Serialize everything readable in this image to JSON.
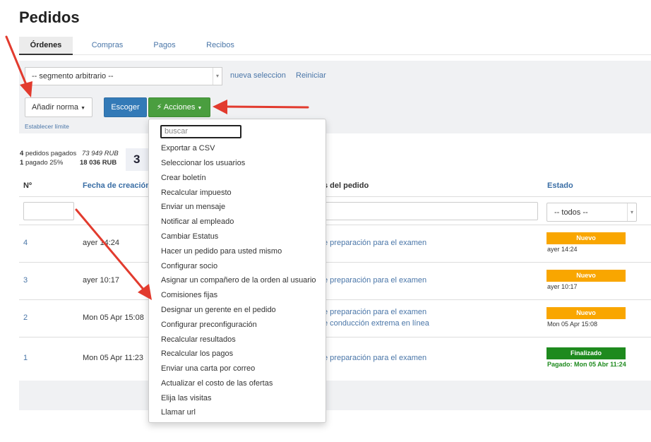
{
  "page": {
    "title": "Pedidos"
  },
  "tabs": [
    {
      "label": "Órdenes",
      "active": true
    },
    {
      "label": "Compras",
      "active": false
    },
    {
      "label": "Pagos",
      "active": false
    },
    {
      "label": "Recibos",
      "active": false
    }
  ],
  "filters": {
    "segment_value": "-- segmento arbitrario --",
    "new_selection": "nueva seleccion",
    "reset": "Reiniciar",
    "add_rule": "Añadir norma",
    "choose": "Escoger",
    "actions": "Acciones",
    "set_limit": "Establecer límite"
  },
  "stats": {
    "paid_count": "4",
    "paid_label": "pedidos pagados",
    "paid_amount": "73 949 RUB",
    "partial_count": "1",
    "partial_label": "pagado 25%",
    "partial_amount": "18 036 RUB",
    "box_value": "3"
  },
  "table": {
    "col_num": "Nº",
    "col_date": "Fecha de creación",
    "col_order": "s del pedido",
    "col_status": "Estado",
    "status_filter": "-- todos --",
    "rows": [
      {
        "id": "4",
        "date": "ayer 14:24",
        "line1": "e preparación para el examen",
        "line2": "",
        "badge": "Nuevo",
        "badge_date": "ayer 14:24"
      },
      {
        "id": "3",
        "date": "ayer 10:17",
        "line1": "e preparación para el examen",
        "line2": "",
        "badge": "Nuevo",
        "badge_date": "ayer 10:17"
      },
      {
        "id": "2",
        "date": "Mon 05 Apr 15:08",
        "line1": "e preparación para el examen",
        "line2": "e conducción extrema en línea",
        "badge": "Nuevo",
        "badge_date": "Mon 05 Apr 15:08"
      },
      {
        "id": "1",
        "date": "Mon 05 Apr 11:23",
        "line1": "e preparación para el examen",
        "line2": "",
        "badge": "Finalizado",
        "badge_date": "Pagado: Mon 05 Abr 11:24"
      }
    ]
  },
  "actions_menu": {
    "search_placeholder": "buscar",
    "items": [
      "Exportar a CSV",
      "Seleccionar los usuarios",
      "Crear boletín",
      "Recalcular impuesto",
      "Enviar un mensaje",
      "Notificar al empleado",
      "Cambiar Estatus",
      "Hacer un pedido para usted mismo",
      "Configurar socio",
      "Asignar un compañero de la orden al usuario",
      "Comisiones fijas",
      "Designar un gerente en el pedido",
      "Configurar preconfiguración",
      "Recalcular resultados",
      "Recalcular los pagos",
      "Enviar una carta por correo",
      "Actualizar el costo de las ofertas",
      "Elija las visitas",
      "Llamar url"
    ]
  },
  "colors": {
    "accent_blue": "#337ab7",
    "action_green": "#4a9e3f",
    "badge_new": "#f9a600",
    "badge_done": "#1e8a1e",
    "annotation_red": "#e23b2e"
  }
}
